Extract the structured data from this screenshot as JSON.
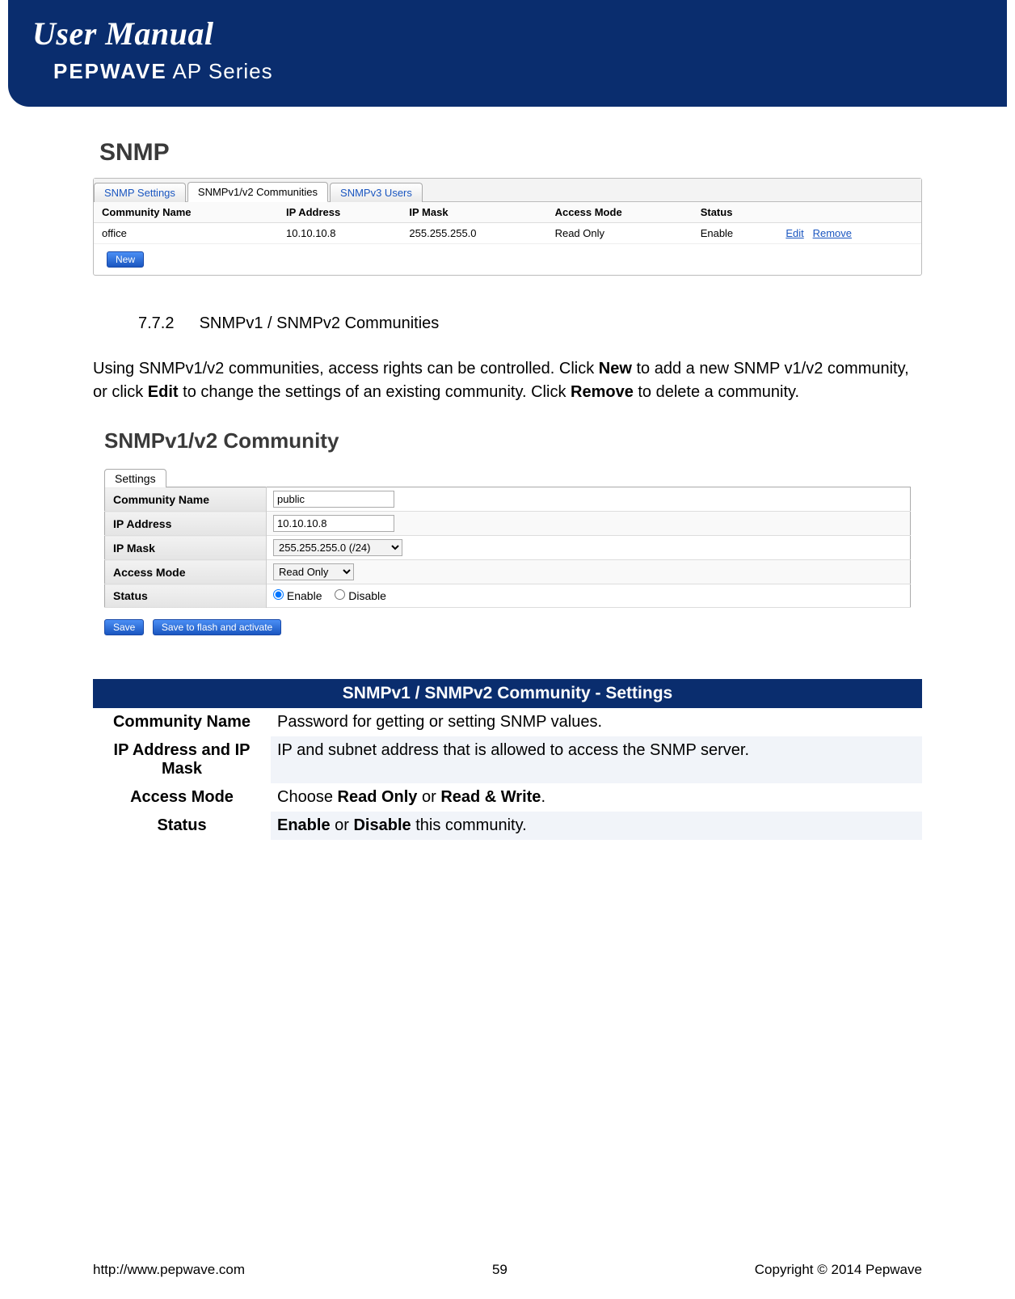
{
  "header": {
    "title": "User Manual",
    "brand": "PEPWAVE",
    "series": " AP Series"
  },
  "snmp": {
    "heading": "SNMP",
    "tabs": [
      "SNMP Settings",
      "SNMPv1/v2 Communities",
      "SNMPv3 Users"
    ],
    "columns": [
      "Community Name",
      "IP Address",
      "IP Mask",
      "Access Mode",
      "Status",
      ""
    ],
    "row": {
      "name": "office",
      "ip": "10.10.10.8",
      "mask": "255.255.255.0",
      "mode": "Read Only",
      "status": "Enable",
      "actions": [
        "Edit",
        "Remove"
      ]
    },
    "new_btn": "New"
  },
  "section": {
    "num": "7.7.2",
    "title": "SNMPv1 / SNMPv2 Communities"
  },
  "para": {
    "p1a": "Using SNMPv1/v2 communities, access rights can be controlled. Click ",
    "p1b": "New",
    "p1c": " to add a new SNMP v1/v2 community, or click ",
    "p1d": "Edit",
    "p1e": " to change the settings of an existing community. Click ",
    "p1f": "Remove",
    "p1g": " to delete a community."
  },
  "community": {
    "heading": "SNMPv1/v2 Community",
    "tab": "Settings",
    "fields": {
      "name": {
        "label": "Community Name",
        "value": "public"
      },
      "ip": {
        "label": "IP Address",
        "value": "10.10.10.8"
      },
      "mask": {
        "label": "IP Mask",
        "value": "255.255.255.0 (/24)"
      },
      "mode": {
        "label": "Access Mode",
        "value": "Read Only"
      },
      "status": {
        "label": "Status",
        "enable": "Enable",
        "disable": "Disable"
      }
    },
    "save_btn": "Save",
    "activate_btn": "Save to flash and activate"
  },
  "defs": {
    "header": "SNMPv1 / SNMPv2 Community - Settings",
    "rows": [
      {
        "k": "Community Name",
        "v": "Password for getting or setting SNMP values."
      },
      {
        "k": "IP Address and IP Mask",
        "v": "IP and subnet address that is allowed to access the SNMP server."
      },
      {
        "k": "Access Mode",
        "v_pre": "Choose ",
        "v_b1": "Read Only",
        "v_mid": " or ",
        "v_b2": "Read & Write",
        "v_post": "."
      },
      {
        "k": "Status",
        "v_b1": "Enable",
        "v_mid": " or ",
        "v_b2": "Disable",
        "v_post": " this community."
      }
    ]
  },
  "footer": {
    "url": "http://www.pepwave.com",
    "page": "59",
    "copy": "Copyright  ©  2014  Pepwave"
  }
}
